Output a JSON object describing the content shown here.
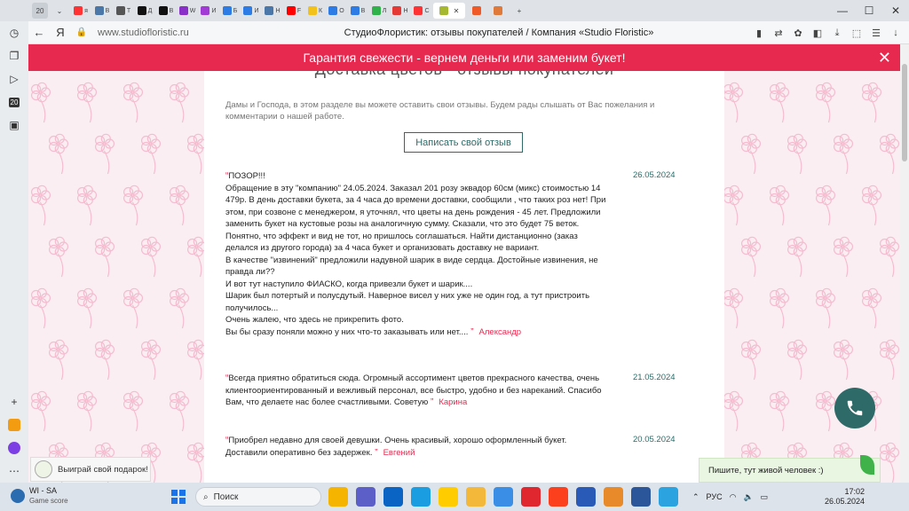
{
  "browser": {
    "tab_count": "20",
    "tabs": [
      {
        "icon": "yandex-icon",
        "color": "#ff3333",
        "label": "я"
      },
      {
        "icon": "vk-icon",
        "color": "#4a76a8",
        "label": "В"
      },
      {
        "icon": "text-icon",
        "color": "#555555",
        "label": "Т"
      },
      {
        "icon": "dzen-icon",
        "color": "#111111",
        "label": "Д"
      },
      {
        "icon": "dzen-icon",
        "color": "#111111",
        "label": "В"
      },
      {
        "icon": "wildberries-icon",
        "color": "#8b2fc9",
        "label": "W"
      },
      {
        "icon": "wildberries-icon",
        "color": "#a23bd6",
        "label": "И"
      },
      {
        "icon": "blue-icon",
        "color": "#2d7be5",
        "label": "Б"
      },
      {
        "icon": "blue-icon",
        "color": "#2d7be5",
        "label": "И"
      },
      {
        "icon": "vk-icon",
        "color": "#4a76a8",
        "label": "Н"
      },
      {
        "icon": "youtube-icon",
        "color": "#ff0000",
        "label": "F"
      },
      {
        "icon": "yellow-icon",
        "color": "#f2c21b",
        "label": "К"
      },
      {
        "icon": "blue-ring-icon",
        "color": "#2d7be5",
        "label": "О"
      },
      {
        "icon": "blue-icon",
        "color": "#2d7be5",
        "label": "В"
      },
      {
        "icon": "green-icon",
        "color": "#2fb24a",
        "label": "Л"
      },
      {
        "icon": "red-icon",
        "color": "#e53935",
        "label": "Н"
      },
      {
        "icon": "yandex-icon",
        "color": "#ff3333",
        "label": "С"
      }
    ],
    "url": "www.studiofloristic.ru",
    "page_title": "СтудиоФлористик: отзывы покупателей / Компания «Studio Floristic»"
  },
  "banner": {
    "text": "Гарантия свежести - вернем деньги или заменим букет!"
  },
  "page": {
    "heading": "Доставка цветов - отзывы покупателей",
    "intro": "Дамы и Господа, в этом разделе вы можете оставить свои отзывы. Будем рады слышать от Вас пожелания и комментарии о нашей работе.",
    "write_button": "Написать свой отзыв"
  },
  "reviews": [
    {
      "text": "ПОЗОР!!!\nОбращение в эту \"компанию\" 24.05.2024. Заказал 201 розу эквадор 60см (микс) стоимостью 14 479р. В день доставки букета, за 4 часа до времени доставки, сообщили , что таких роз нет! При этом, при созвоне с менеджером, я уточнял, что цветы на день рождения - 45 лет. Предложили заменить букет на кустовые розы на аналогичную сумму. Сказали, что это будет 75 веток.\nПонятно, что эффект и вид не тот, но пришлось соглашаться. Найти дистанционно (заказ делался из другого города) за 4 часа букет и организовать доставку не вариант.\nВ качестве \"извинений\" предложили надувной шарик в виде сердца. Достойные извинения, не правда ли??\nИ вот тут наступило ФИАСКО, когда привезли букет и шарик....\nШарик был потертый и полусдутый. Наверное висел у них уже не один год, а тут пристроить получилось...\nОчень жалею, что здесь не прикрепить фото.\nВы бы сразу поняли можно у них что-то заказывать или нет....",
      "author": "Александр",
      "date": "26.05.2024"
    },
    {
      "text": "Всегда приятно обратиться сюда. Огромный ассортимент цветов прекрасного качества, очень клиентоориентированный и вежливый персонал, все быстро, удобно и без нареканий. Спасибо Вам, что делаете нас более счастливыми. Советую",
      "author": "Карина",
      "date": "21.05.2024"
    },
    {
      "text": "Приобрел недавно для своей девушки. Очень красивый, хорошо оформленный букет. Доставили оперативно без задержек.",
      "author": "Евгений",
      "date": "20.05.2024"
    }
  ],
  "widgets": {
    "gift": "Выиграй свой подарок!",
    "chat": "Пишите, тут живой человек :)"
  },
  "taskbar": {
    "weather_title": "WI - SA",
    "weather_sub": "Game score",
    "search_placeholder": "Поиск",
    "lang": "РУС",
    "time": "17:02",
    "date": "26.05.2024"
  },
  "colors": {
    "accent_red": "#e8294f",
    "teal": "#2e6b68",
    "pattern_pink": "#f5bcd0"
  }
}
